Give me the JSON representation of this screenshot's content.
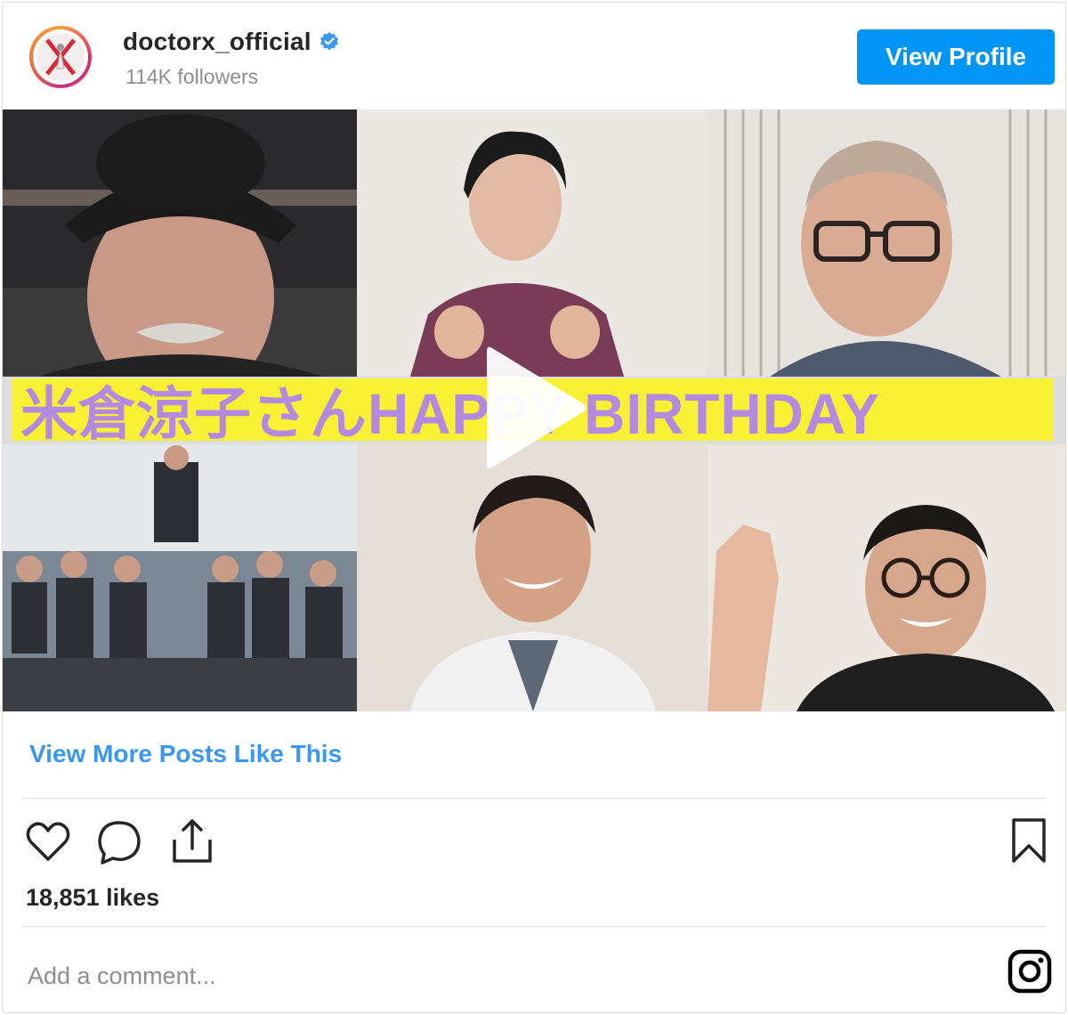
{
  "header": {
    "username": "doctorx_official",
    "followers": "114K followers",
    "view_profile_label": "View Profile",
    "avatar_icon": "doctorx-logo-icon",
    "verified_icon": "verified-badge-icon"
  },
  "media": {
    "banner_text": "米倉涼子さんHAPPY BIRTHDAY",
    "banner_color": "#f7f033",
    "banner_text_color": "#b48ae0",
    "play_icon": "play-icon"
  },
  "more_link": "View More Posts Like This",
  "actions": {
    "like_icon": "heart-icon",
    "comment_icon": "comment-icon",
    "share_icon": "share-icon",
    "save_icon": "bookmark-icon"
  },
  "likes": "18,851 likes",
  "comment": {
    "placeholder": "Add a comment...",
    "instagram_icon": "instagram-icon"
  },
  "colors": {
    "brand_blue": "#0095f6",
    "link_blue": "#3897f0",
    "muted": "#8e8e8e"
  }
}
